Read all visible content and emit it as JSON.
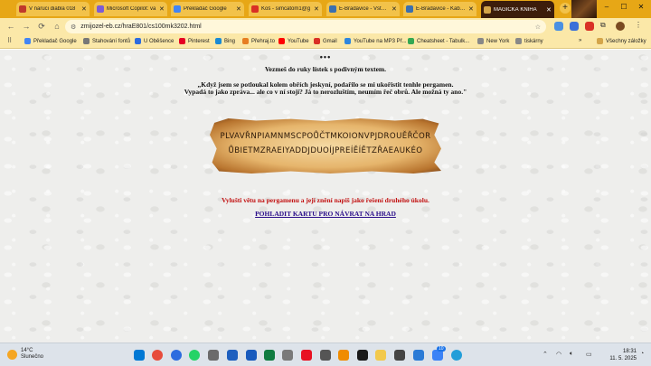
{
  "browser": {
    "tabs": [
      {
        "title": "V naruci diabla 018",
        "color": "#c0392b",
        "active": false
      },
      {
        "title": "Microsoft Copilot: va",
        "color": "#7b5cd6",
        "active": false
      },
      {
        "title": "Překladač Google",
        "color": "#4285f4",
        "active": false
      },
      {
        "title": "Koš - simcatom1@g",
        "color": "#d93025",
        "active": false
      },
      {
        "title": "E-Bradavice - Vstupe",
        "color": "#3a6fb0",
        "active": false
      },
      {
        "title": "E-Bradavice - Kabine",
        "color": "#3a6fb0",
        "active": false
      },
      {
        "title": "MAGICKÁ KNIHA",
        "color": "#d4a54a",
        "active": true
      }
    ],
    "new_tab_symbol": "+",
    "window_controls": {
      "minimize": "–",
      "maximize": "☐",
      "close": "✕"
    },
    "address": "zmijozel-eb.cz/hraE801/cs100mk3202.html",
    "bookmarks": [
      {
        "label": "Překladač Google",
        "color": "#4285f4"
      },
      {
        "label": "Stahování fontů",
        "color": "#777777"
      },
      {
        "label": "U Oběšence",
        "color": "#2d6cdf"
      },
      {
        "label": "Pinterest",
        "color": "#e60023"
      },
      {
        "label": "Bing",
        "color": "#1a8ad4"
      },
      {
        "label": "Přehraj.to",
        "color": "#e67e22"
      },
      {
        "label": "YouTube",
        "color": "#ff0000"
      },
      {
        "label": "Gmail",
        "color": "#d93025"
      },
      {
        "label": "YouTube na MP3 Př...",
        "color": "#2e86de"
      },
      {
        "label": "Cheatsheet - Tabulk...",
        "color": "#34a853"
      },
      {
        "label": "New York",
        "color": "#888888"
      },
      {
        "label": "tiskárny",
        "color": "#888888"
      }
    ],
    "bookmarks_more": "»",
    "all_bookmarks": "Všechny záložky"
  },
  "page": {
    "dots": "•••",
    "intro": "Vezmeš do ruky lístek s podivným textem.",
    "quote_line1": "„Když jsem se potloukal kolem obřích jeskyní, podařilo se mi ukořistit tenhle pergamen.",
    "quote_line2": "Vypadá to jako zpráva... ale co v ní stojí? Já to nerozluštím, neumím řeč obrů. Ale možná ty ano.\"",
    "cipher_line1": "PLVAVŘNPIAMNMSCPOŮČTMKOIONVPJDROUĚŘČOR",
    "cipher_line2": "ŮBIETMZRAEIYADDJDUOÍJPREÍĚÍĚTZŘAEAUKÉO",
    "task": "Vylušti větu na pergamenu a její znění napiš jako řešení druhého úkolu.",
    "map_link": "POHLADIT KARTU PRO NÁVRAT NA HRAD"
  },
  "taskbar": {
    "temperature": "14°C",
    "weather": "Slunečno",
    "time": "18:31",
    "date": "11. 5. 2025",
    "notification_count": "10"
  }
}
